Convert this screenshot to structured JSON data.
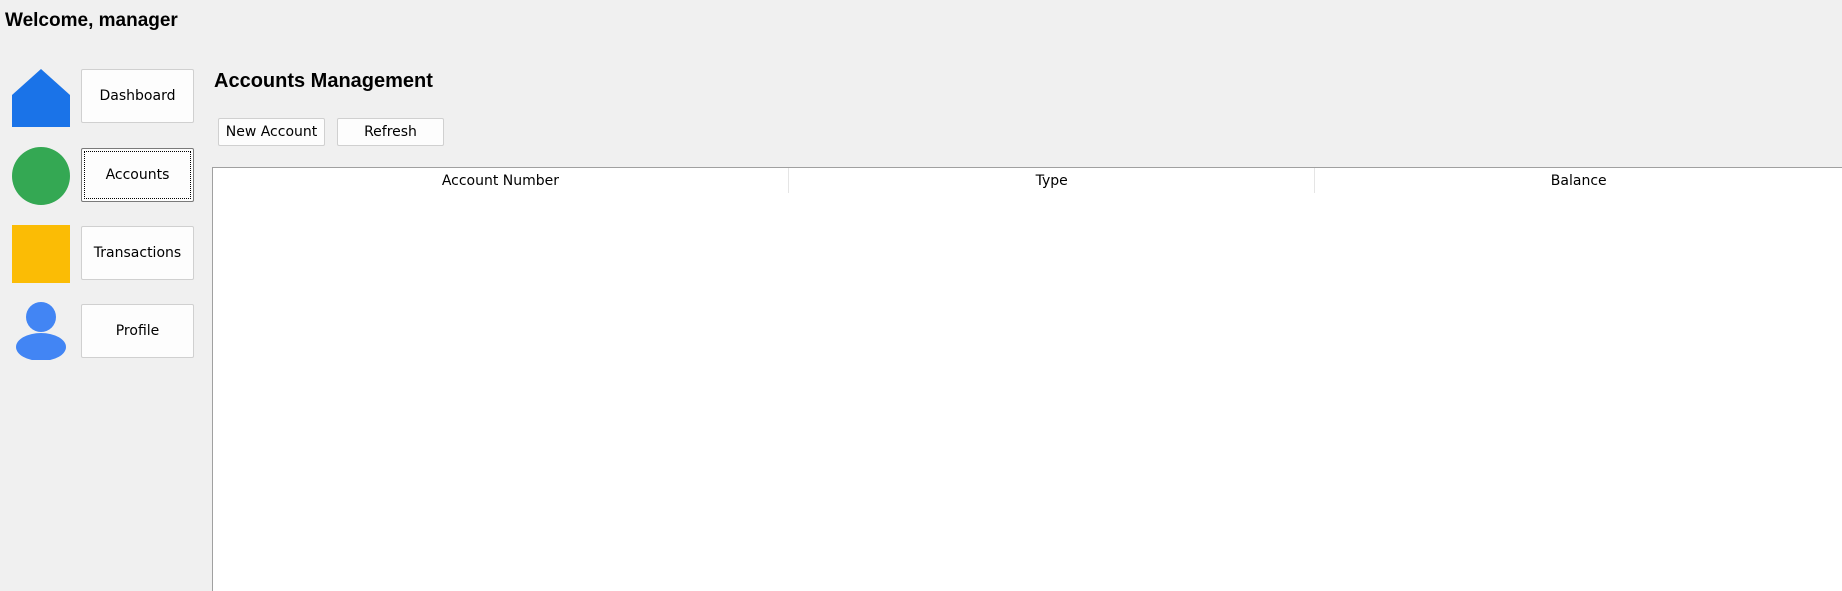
{
  "header": {
    "welcome_text": "Welcome, manager"
  },
  "sidebar": {
    "items": [
      {
        "label": "Dashboard",
        "icon": "home-icon",
        "color": "#1a73e8"
      },
      {
        "label": "Accounts",
        "icon": "circle-icon",
        "color": "#34a853",
        "focused": true
      },
      {
        "label": "Transactions",
        "icon": "square-icon",
        "color": "#fbbc05"
      },
      {
        "label": "Profile",
        "icon": "person-icon",
        "color": "#4285f4"
      }
    ]
  },
  "main": {
    "title": "Accounts Management",
    "toolbar": {
      "new_account_label": "New Account",
      "refresh_label": "Refresh"
    },
    "table": {
      "columns": [
        "Account Number",
        "Type",
        "Balance"
      ],
      "rows": []
    }
  }
}
